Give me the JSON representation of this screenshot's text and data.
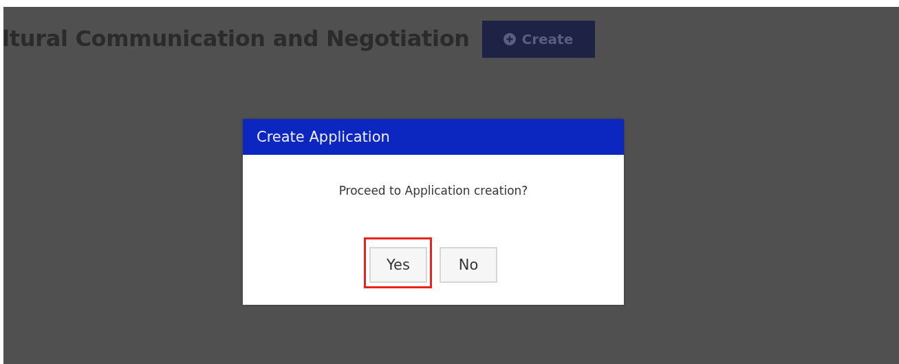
{
  "page": {
    "heading": "ltural Communication and Negotiation",
    "create_button": {
      "label": "Create"
    }
  },
  "dialog": {
    "title": "Create Application",
    "message": "Proceed to Application creation?",
    "buttons": [
      {
        "label": "Yes",
        "highlighted": true
      },
      {
        "label": "No",
        "highlighted": false
      }
    ]
  }
}
